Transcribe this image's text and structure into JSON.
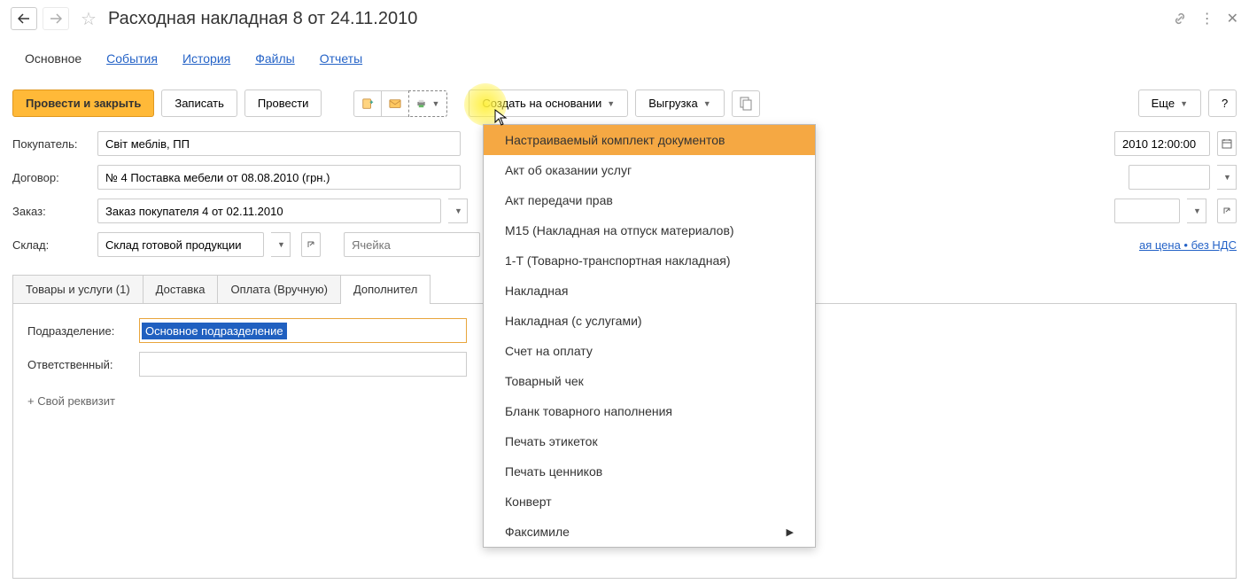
{
  "titlebar": {
    "title": "Расходная накладная 8 от 24.11.2010"
  },
  "tabs": {
    "items": [
      "Основное",
      "События",
      "История",
      "Файлы",
      "Отчеты"
    ]
  },
  "toolbar": {
    "post_close": "Провести и закрыть",
    "save": "Записать",
    "post": "Провести",
    "create_based": "Создать на основании",
    "upload": "Выгрузка",
    "more": "Еще",
    "help": "?"
  },
  "form": {
    "buyer_label": "Покупатель:",
    "buyer_value": "Світ меблів, ПП",
    "contract_label": "Договор:",
    "contract_value": "№ 4 Поставка мебели от 08.08.2010 (грн.)",
    "order_label": "Заказ:",
    "order_value": "Заказ покупателя 4 от 02.11.2010",
    "warehouse_label": "Склад:",
    "warehouse_value": "Склад готовой продукции",
    "cell_placeholder": "Ячейка",
    "date_value": "2010 12:00:00",
    "price_link": "ая цена • без НДС"
  },
  "subtabs": {
    "items": [
      "Товары и услуги (1)",
      "Доставка",
      "Оплата (Вручную)",
      "Дополнител"
    ]
  },
  "subcontent": {
    "division_label": "Подразделение:",
    "division_value": "Основное подразделение",
    "responsible_label": "Ответственный:",
    "add_field": "+ Свой реквизит"
  },
  "dropdown": {
    "items": [
      "Настраиваемый комплект документов",
      "Акт об оказании услуг",
      "Акт передачи прав",
      "М15 (Накладная на отпуск материалов)",
      "1-Т (Товарно-транспортная накладная)",
      "Накладная",
      "Накладная (с услугами)",
      "Счет на оплату",
      "Товарный чек",
      "Бланк товарного наполнения",
      "Печать этикеток",
      "Печать ценников",
      "Конверт",
      "Факсимиле"
    ]
  }
}
